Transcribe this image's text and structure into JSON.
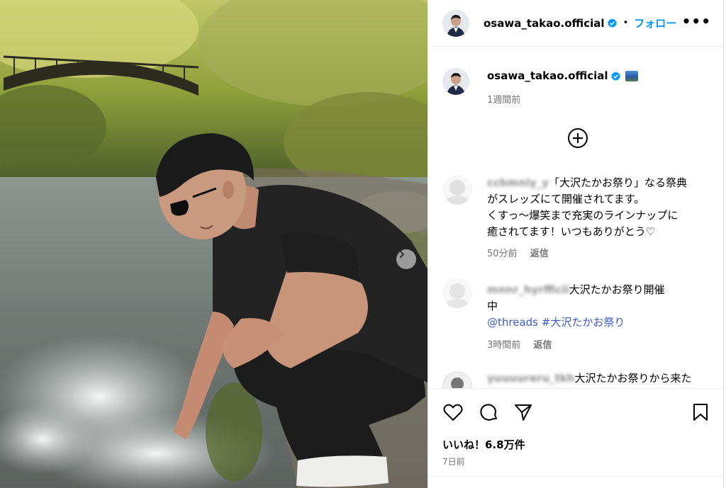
{
  "post": {
    "username": "osawa_takao.official",
    "follow_label": "フォロー",
    "dot": "•",
    "more": "•••"
  },
  "caption": {
    "username": "osawa_takao.official",
    "time": "1週間前"
  },
  "comments": [
    {
      "username": "ccbmniy_y",
      "text_lines": [
        "「大沢たかお祭り」なる祭典",
        "がスレッズにて開催されてます。",
        "くすっ〜爆笑まで充実のラインナップに",
        "癒されてます！いつもありがとう♡"
      ],
      "time": "50分前",
      "reply": "返信"
    },
    {
      "username": "mnnr_hyrfficii",
      "text_lines": [
        "大沢たかお祭り開催",
        "中"
      ],
      "mention": "@threads",
      "hashtag": "#大沢たかお祭り",
      "time": "3時間前",
      "reply": "返信"
    },
    {
      "username": "yuuuureru_tkh",
      "text_lines": [
        "大沢たかお祭りから来た"
      ]
    }
  ],
  "likes": "いいね！6.8万件",
  "date": "7日前",
  "icons": {
    "verified": "verified-badge-icon",
    "emoji": "landscape-emoji-icon",
    "load_more": "plus-circle-icon",
    "like": "heart-icon",
    "comment": "comment-icon",
    "share": "share-icon",
    "save": "bookmark-icon",
    "carousel": "chevron-right-icon"
  },
  "colors": {
    "accent": "#0095f6",
    "verified": "#0095f6",
    "link": "#3b5cc8",
    "muted": "#737373"
  }
}
